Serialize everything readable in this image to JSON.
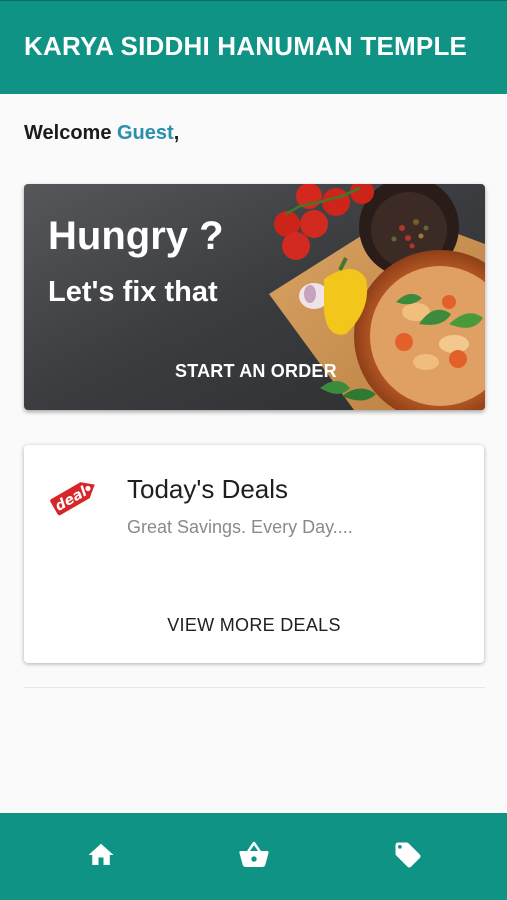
{
  "app_bar": {
    "title": "KARYA SIDDHI HANUMAN TEMPLE"
  },
  "welcome": {
    "prefix": "Welcome ",
    "user": "Guest",
    "suffix": ","
  },
  "hero": {
    "title": "Hungry ?",
    "subtitle": "Let's fix that",
    "cta": "START AN ORDER"
  },
  "deals": {
    "title": "Today's Deals",
    "subtitle": "Great Savings. Every Day....",
    "action": "VIEW MORE DEALS",
    "icon_text": "deal"
  },
  "bottom_nav": {
    "items": [
      {
        "icon": "home-icon"
      },
      {
        "icon": "basket-icon"
      },
      {
        "icon": "tag-icon"
      }
    ]
  },
  "colors": {
    "primary": "#0e9384",
    "accent": "#2a8fae",
    "background": "#fafafa"
  }
}
